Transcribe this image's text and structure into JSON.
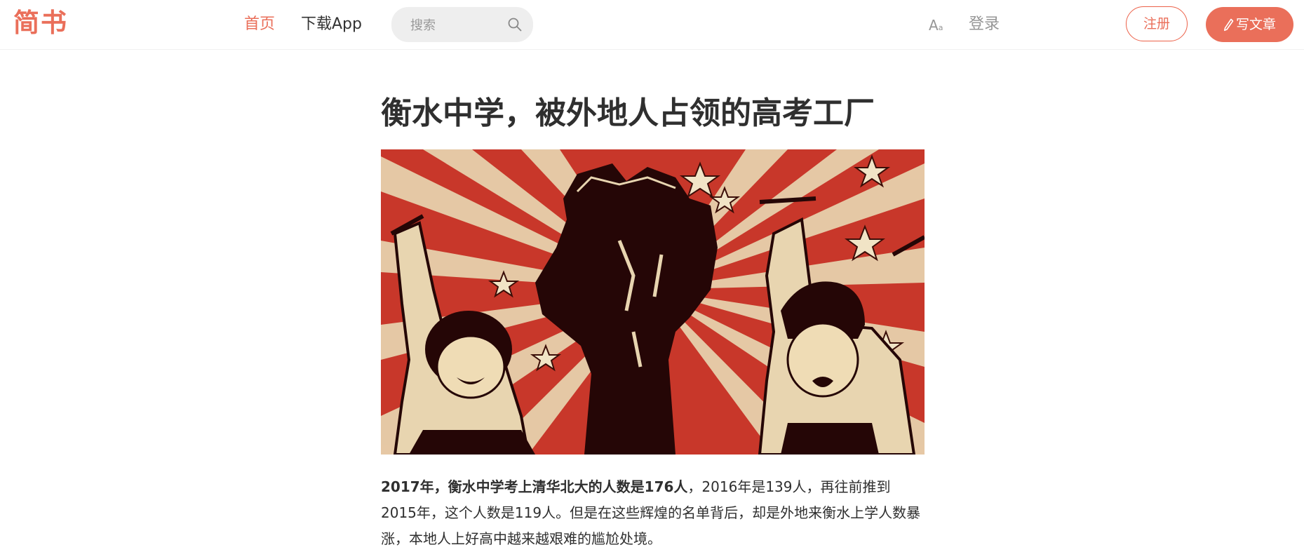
{
  "header": {
    "logo": "简书",
    "nav": {
      "home": "首页",
      "app": "下载App"
    },
    "search": {
      "placeholder": "搜索",
      "icon": "search-icon"
    },
    "font_toggle": {
      "big": "A",
      "small": "a"
    },
    "login": "登录",
    "register": "注册",
    "write": "写文章"
  },
  "article": {
    "title": "衡水中学，被外地人占领的高考工厂",
    "hero_image": "propaganda-poster-raised-fist-students",
    "lead_bold": "2017年，衡水中学考上清华北大的人数是176人",
    "lead_rest": "，2016年是139人，再往前推到2015年，这个人数是119人。但是在这些辉煌的名单背后，却是外地来衡水上学人数暴涨，本地人上好高中越来越艰难的尴尬处境。"
  },
  "colors": {
    "brand": "#ea6f5a",
    "text": "#2f2f2f",
    "muted": "#969696"
  }
}
